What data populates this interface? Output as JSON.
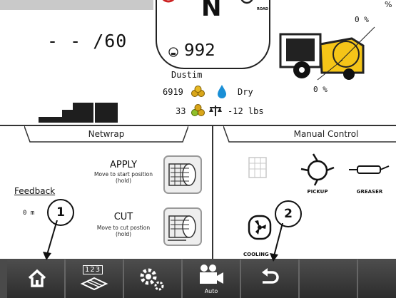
{
  "header": {
    "gear": "N",
    "road_label": "ROAD",
    "corner_percent_top": "%",
    "speed_display": "- - /60",
    "fuel_value": "992",
    "crop_name": "Dustim",
    "bale_count": "6919",
    "moisture": "Dry",
    "bale_count_2": "33",
    "weight": "-12 lbs",
    "fill_percent_right": "0 %",
    "fill_percent_left": "0 %"
  },
  "netwrap": {
    "title": "Netwrap",
    "apply_label": "APPLY",
    "apply_sub": "Move to start position (hold)",
    "cut_label": "CUT",
    "cut_sub": "Move to cut postion (hold)",
    "feedback_label": "Feedback",
    "feedback_value": "0 m"
  },
  "manual_control": {
    "title": "Manual Control",
    "pickup_label": "PICKUP",
    "greaser_label": "GREASER",
    "cooling_label": "COOLING"
  },
  "toolbar": {
    "field_label": "123",
    "camera_label": "Auto"
  },
  "callouts": [
    "1",
    "2"
  ],
  "colors": {
    "accent_yellow": "#f5c518",
    "toolbar_dark": "#2f2f2f",
    "moisture_blue": "#1a8fd6"
  }
}
